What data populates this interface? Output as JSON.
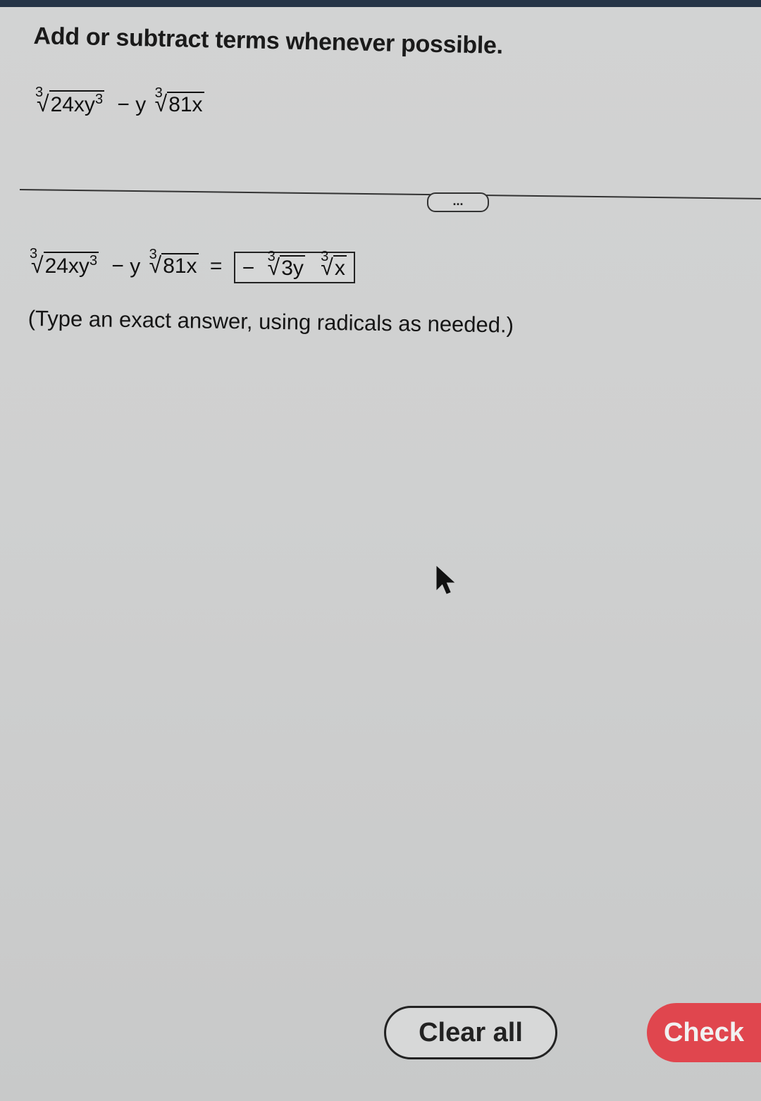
{
  "question": {
    "instruction": "Add or subtract terms whenever possible.",
    "expression": {
      "term1": {
        "index": "3",
        "radicand": "24xy",
        "exponent": "3"
      },
      "operator": "−",
      "term2": {
        "coefficient": "y",
        "index": "3",
        "radicand": "81x"
      }
    }
  },
  "more_button_label": "...",
  "answer": {
    "equals": "=",
    "box": {
      "sign": "−",
      "rad1": {
        "index": "3",
        "radicand": "3y"
      },
      "rad2": {
        "index": "3",
        "radicand": "x"
      }
    },
    "hint": "(Type an exact answer, using radicals as needed.)"
  },
  "buttons": {
    "clear_all": "Clear all",
    "check": "Check"
  },
  "colors": {
    "check_button": "#e0464e",
    "background": "#cfd0d0",
    "top_strip": "#253447"
  }
}
